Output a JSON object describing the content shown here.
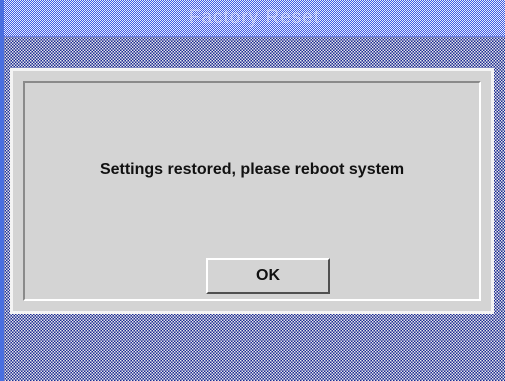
{
  "window": {
    "title": "Factory Reset"
  },
  "dialog": {
    "message": "Settings restored, please reboot system",
    "ok_label": "OK"
  },
  "colors": {
    "background_pattern_dark": "#1b2a96",
    "background_pattern_light": "#e6e6e6",
    "dialog_face": "#d4d4d4",
    "title_pattern": "#3e5be0",
    "left_edge": "#4a6fe0"
  }
}
